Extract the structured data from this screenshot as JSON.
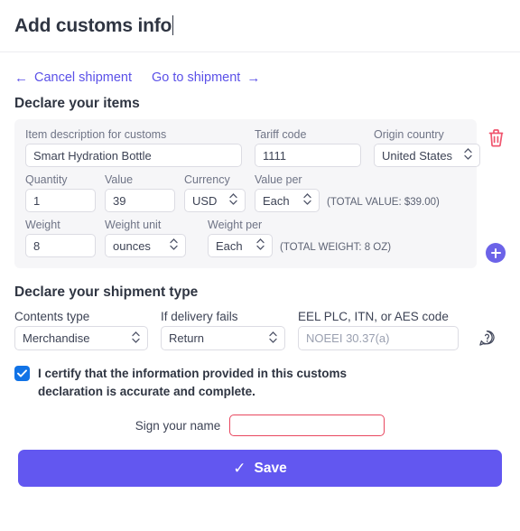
{
  "header": {
    "title": "Add customs info"
  },
  "nav": {
    "cancel_label": "Cancel shipment",
    "cancel_arrow": "←",
    "goto_label": "Go to shipment",
    "goto_arrow": "→"
  },
  "items_section": {
    "title": "Declare your items",
    "labels": {
      "description": "Item description for customs",
      "tariff": "Tariff code",
      "origin": "Origin country",
      "quantity": "Quantity",
      "value": "Value",
      "currency": "Currency",
      "value_per": "Value per",
      "weight": "Weight",
      "weight_unit": "Weight unit",
      "weight_per": "Weight per"
    },
    "item": {
      "description": "Smart Hydration Bottle",
      "tariff": "1111",
      "origin": "United States",
      "quantity": "1",
      "value": "39",
      "currency": "USD",
      "value_per": "Each",
      "weight": "8",
      "weight_unit": "ounces",
      "weight_per": "Each",
      "total_value_note": "(TOTAL VALUE: $39.00)",
      "total_weight_note": "(TOTAL WEIGHT: 8 OZ)"
    },
    "delete_icon": "trash-icon",
    "add_icon": "plus-icon"
  },
  "shipment_section": {
    "title": "Declare your shipment type",
    "labels": {
      "contents_type": "Contents type",
      "delivery_fails": "If delivery fails",
      "eel_code": "EEL PLC, ITN, or AES code"
    },
    "contents_type": "Merchandise",
    "delivery_fails": "Return",
    "eel_placeholder": "NOEEI 30.37(a)",
    "eel_value": "",
    "help_icon": "question-bubble-icon"
  },
  "certify": {
    "checked": true,
    "text": "I certify that the information provided in this customs declaration is accurate and complete."
  },
  "sign": {
    "label": "Sign your name",
    "value": "",
    "placeholder": ""
  },
  "save": {
    "label": "Save",
    "check_glyph": "✓"
  },
  "glyphs": {
    "select_chevron": "⌃⌄"
  },
  "colors": {
    "accent_purple": "#6257f0",
    "link_purple": "#5b51e8",
    "danger_red": "#e8475f",
    "checkbox_blue": "#1173e6",
    "card_grey": "#f6f6f8"
  }
}
